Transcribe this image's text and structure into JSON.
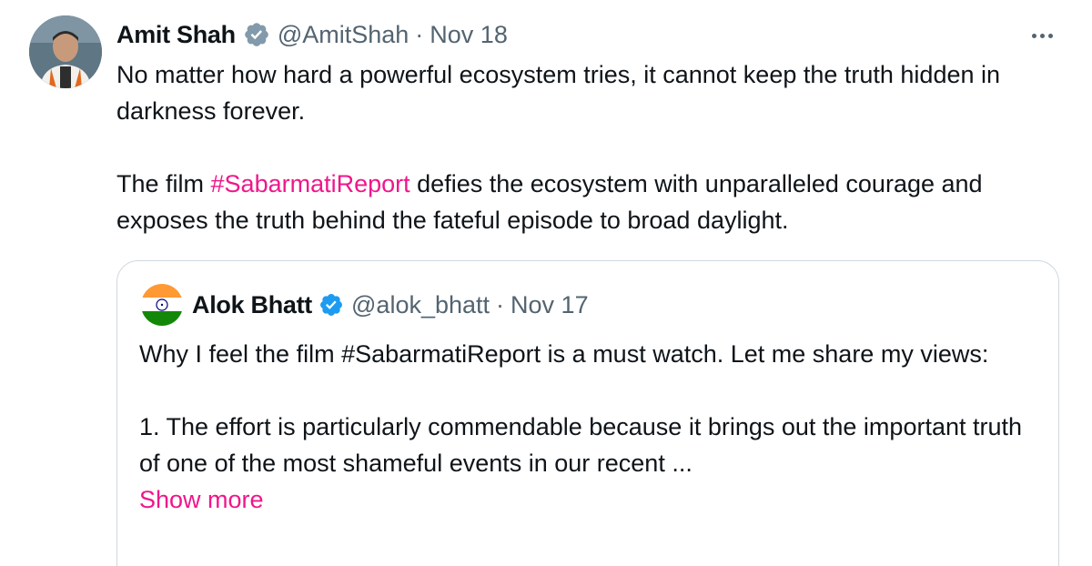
{
  "tweet": {
    "author_name": "Amit Shah",
    "handle": "@AmitShah",
    "separator": "·",
    "date": "Nov 18",
    "more_icon": "more-horizontal-icon",
    "line1": "No matter how hard a powerful ecosystem tries, it cannot keep the truth hidden in darkness forever.",
    "line2_prefix": "The film ",
    "line2_hashtag": "#SabarmatiReport",
    "line2_suffix": " defies the ecosystem with unparalleled courage and exposes the truth behind the fateful episode to broad daylight."
  },
  "quoted": {
    "author_name": "Alok Bhatt",
    "handle": "@alok_bhatt",
    "separator": "·",
    "date": "Nov 17",
    "para1": "Why I feel the film #SabarmatiReport is a must watch. Let me share my views:",
    "para2": "1. The effort is particularly commendable because it brings out the important truth of one of the most shameful events in our recent ...",
    "show_more": "Show more"
  },
  "colors": {
    "hashtag": "#f0168a",
    "verified_grey": "#829aab",
    "verified_blue": "#1d9bf0",
    "muted": "#536471"
  }
}
